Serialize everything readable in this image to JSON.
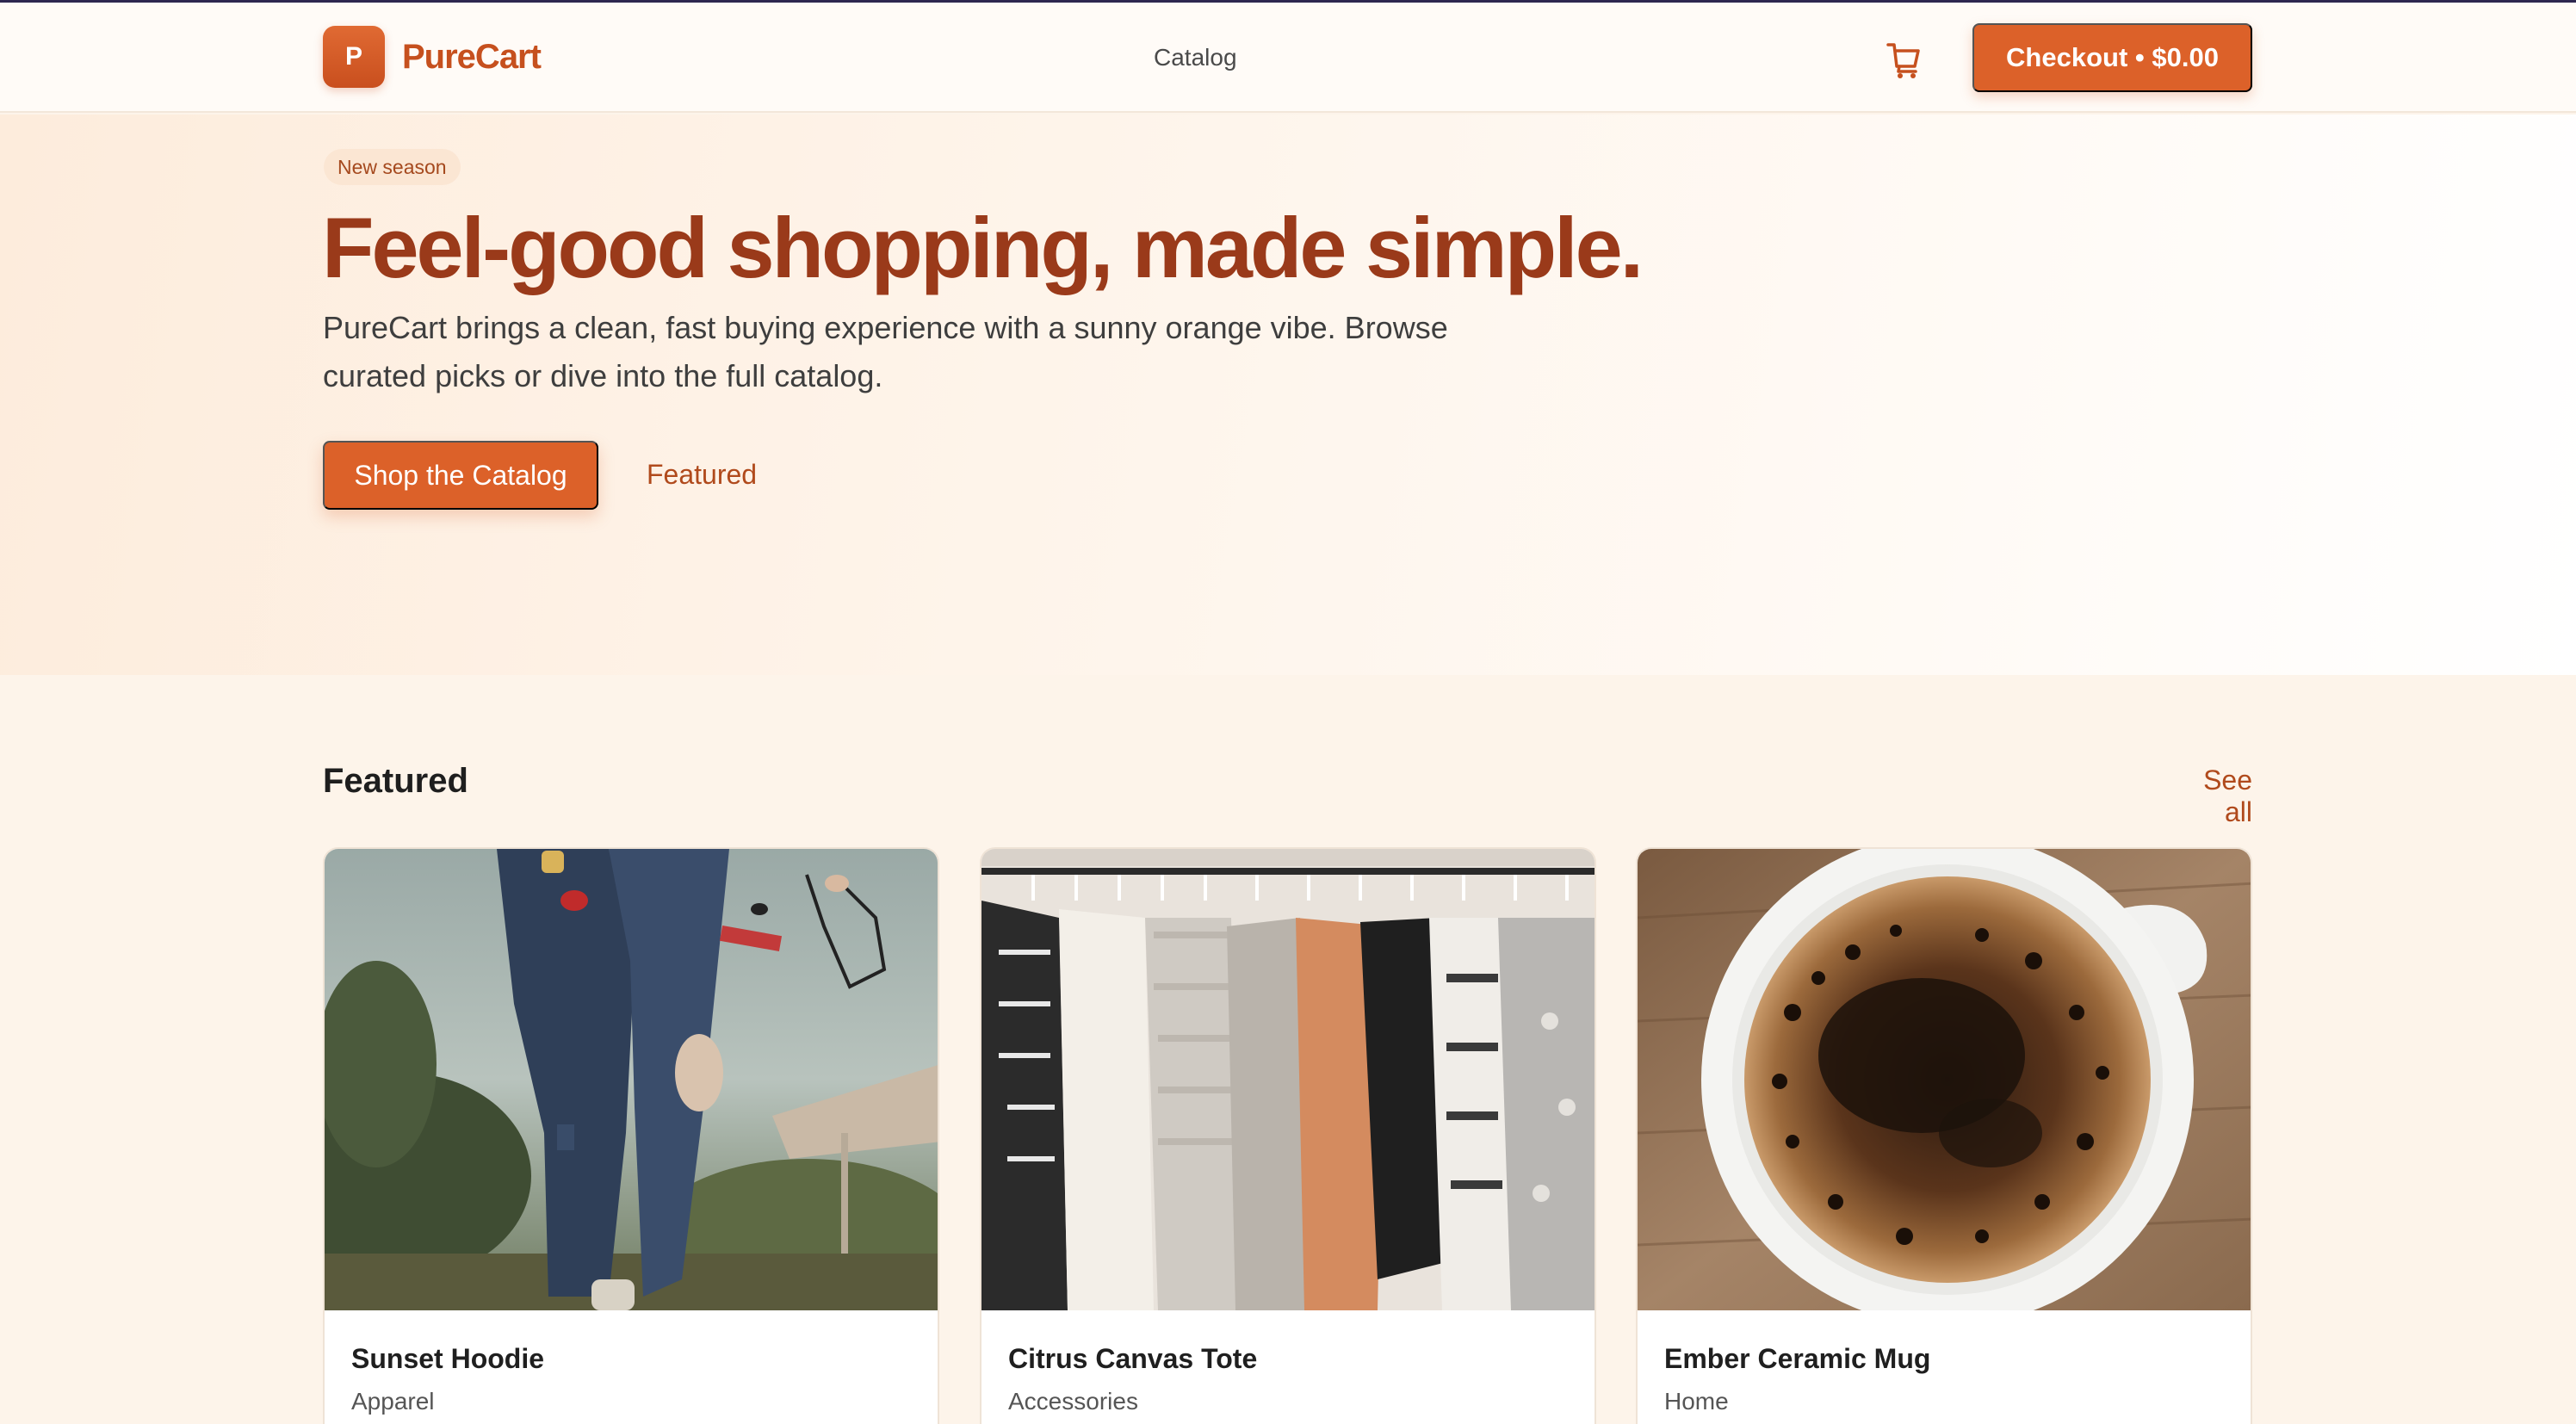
{
  "header": {
    "brand_letter": "P",
    "brand_name": "PureCart",
    "nav_catalog": "Catalog",
    "cart_icon": "cart-icon",
    "checkout_label": "Checkout • $0.00"
  },
  "hero": {
    "badge": "New season",
    "title": "Feel-good shopping, made simple.",
    "subtitle": "PureCart brings a clean, fast buying experience with a sunny orange vibe. Browse curated picks or dive into the full catalog.",
    "primary_cta": "Shop the Catalog",
    "secondary_cta": "Featured"
  },
  "featured": {
    "title": "Featured",
    "see_all": "See all",
    "products": [
      {
        "name": "Sunset Hoodie",
        "category": "Apparel",
        "image": "jeans-photo"
      },
      {
        "name": "Citrus Canvas Tote",
        "category": "Accessories",
        "image": "clothing-rack-photo"
      },
      {
        "name": "Ember Ceramic Mug",
        "category": "Home",
        "image": "coffee-cup-photo"
      }
    ]
  },
  "colors": {
    "accent": "#dc6129",
    "brand_text": "#c6501e",
    "hero_title": "#9a3a1a",
    "link": "#b04a1c",
    "background": "#fdf4ea"
  }
}
